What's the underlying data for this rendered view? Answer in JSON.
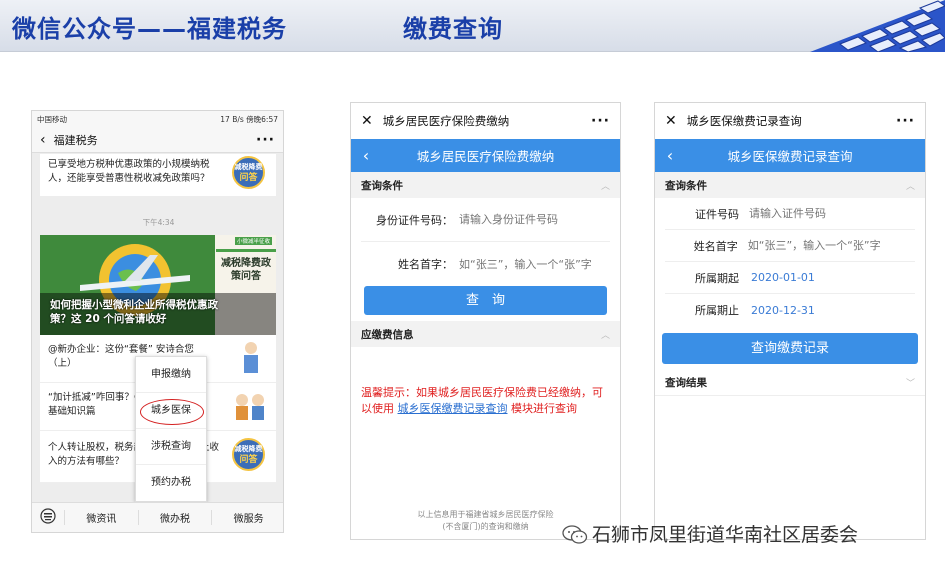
{
  "slide": {
    "title_left": "微信公众号——福建税务",
    "title_right": "缴费查询",
    "watermark": "石狮市凤里街道华南社区居委会"
  },
  "phone1": {
    "status_left": "中国移动",
    "status_right": "17 B/s  傍晚6:57",
    "nav_title": "福建税务",
    "msg1": "已享受地方税种优惠政策的小规模纳税人，还能享受普惠性税收减免政策吗？",
    "badge_top": "减税降费",
    "badge_bottom": "问答",
    "timestamp": "下午4:34",
    "banner_tag": "小微减半征收",
    "banner_side": "减税降费政策问答",
    "banner_caption": "如何把握小型微利企业所得税优惠政策？这 20 个问答请收好",
    "row1": "@新办企业：这份“套餐” 安诗合您（上）",
    "row2": "“加计抵减”咋回事？①基础知识篇",
    "row3": "个人转让股权，税务部门核定股权转让收入的方法有哪些？",
    "popup": [
      "申报缴纳",
      "城乡医保",
      "涉税查询",
      "预约办税"
    ],
    "tabs": [
      "微资讯",
      "微办税",
      "微服务"
    ]
  },
  "phone2": {
    "top_title": "城乡居民医疗保险费缴纳",
    "bar_title": "城乡居民医疗保险费缴纳",
    "section1": "查询条件",
    "id_label": "身份证件号码：",
    "id_placeholder": "请输入身份证件号码",
    "name_label": "姓名首字：",
    "name_placeholder": "如“张三”，输入一个“张”字",
    "query_btn": "查　询",
    "section2": "应缴费信息",
    "notice_a": "温馨提示：如果城乡居民医疗保险费已经缴纳，可以使用",
    "notice_link": "城乡医保缴费记录查询",
    "notice_b": "模块进行查询",
    "footer1": "以上信息用于福建省城乡居民医疗保险",
    "footer2": "(不含厦门)的查询和缴纳"
  },
  "phone3": {
    "top_title": "城乡医保缴费记录查询",
    "bar_title": "城乡医保缴费记录查询",
    "section1": "查询条件",
    "f1_label": "证件号码",
    "f1_placeholder": "请输入证件号码",
    "f2_label": "姓名首字",
    "f2_placeholder": "如“张三”，输入一个“张”字",
    "f3_label": "所属期起",
    "f3_value": "2020-01-01",
    "f4_label": "所属期止",
    "f4_value": "2020-12-31",
    "query_btn": "查询缴费记录",
    "section2": "查询结果"
  },
  "colors": {
    "accent": "#3a8fe6",
    "title": "#1a3fa8",
    "warning": "#e02020"
  }
}
